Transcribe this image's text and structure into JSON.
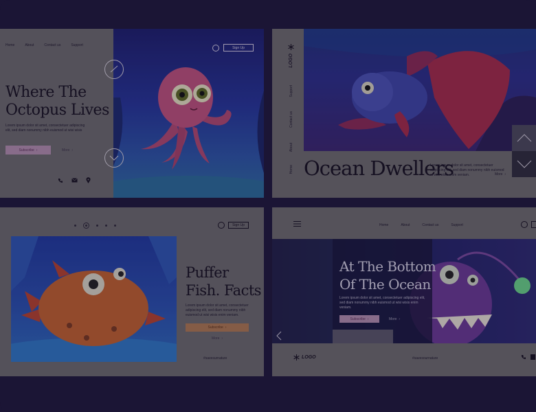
{
  "card1": {
    "nav": [
      "Home",
      "About",
      "Contact us",
      "Support"
    ],
    "signup": "Sign Up",
    "title_line1": "Where The",
    "title_line2": "Octopus Lives",
    "body": "Lorem ipsum dolor sit amet, consectetuer adipiscing elit, sed diam nonummy nibh euismod ut wisi wisis",
    "subscribe": "Subscribe",
    "more": "More"
  },
  "card2": {
    "logo": "LOGO",
    "side_nav": [
      "Support",
      "Contact us",
      "About",
      "Home"
    ],
    "title": "Ocean Dwellers",
    "body": "Lorem ipsum dolor sit amet, consectetuer adipiscing elit, sed diam nonummy nibh euismod ut wisi wisis enim veniam.",
    "more": "More"
  },
  "card3": {
    "signup": "Sign Up",
    "title_line1": "Puffer",
    "title_line2": "Fish. Facts",
    "body": "Lorem ipsum dolor sit amet, consectetuer adipiscing elit, sed diam nonummy nibh euismod ut wisi wisis enim veniam.",
    "subscribe": "Subscribe",
    "more": "More",
    "hashtag": "#savesurnature"
  },
  "card4": {
    "nav": [
      "Home",
      "About",
      "Contact us",
      "Support"
    ],
    "title_line1": "At The Bottom",
    "title_line2": "Of The Ocean",
    "body": "Lorem ipsum dolor sit amet, consectetuer adipiscing elit, sed diam nonummy nibh euismod ut wisi wisis enim veniam.",
    "subscribe": "Subscribe",
    "more": "More",
    "logo": "LOGO",
    "hashtag": "#savesournature"
  },
  "colors": {
    "background": "#1b1535",
    "card_gray": "#6e6c6e",
    "button_pink": "#b491b0",
    "button_orange": "#b07a52",
    "ocean_blue": "#213a96",
    "octopus_pink": "#b24a72"
  },
  "icons": [
    "user-icon",
    "phone-icon",
    "mail-icon",
    "location-pin-icon",
    "snowflake-icon",
    "hamburger-icon",
    "chevron-up-icon",
    "chevron-down-icon",
    "chevron-left-icon",
    "chevron-right-icon"
  ]
}
